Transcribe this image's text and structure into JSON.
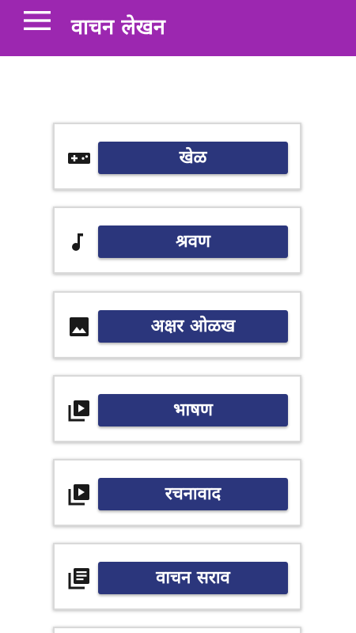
{
  "appbar": {
    "title": "वाचन लेखन",
    "menu_icon": "hamburger-menu-icon",
    "background": "#9c27b0"
  },
  "menu_items": [
    {
      "label": "खेळ",
      "icon": "gamepad-icon"
    },
    {
      "label": "श्रवण",
      "icon": "music-note-icon"
    },
    {
      "label": "अक्षर ओळख",
      "icon": "image-icon"
    },
    {
      "label": "भाषण",
      "icon": "video-library-icon"
    },
    {
      "label": "रचनावाद",
      "icon": "video-library-icon"
    },
    {
      "label": "वाचन सराव",
      "icon": "library-books-icon"
    },
    {
      "label": "",
      "icon": ""
    }
  ],
  "colors": {
    "button": "#2b367c",
    "icon": "#1a1a1a"
  }
}
